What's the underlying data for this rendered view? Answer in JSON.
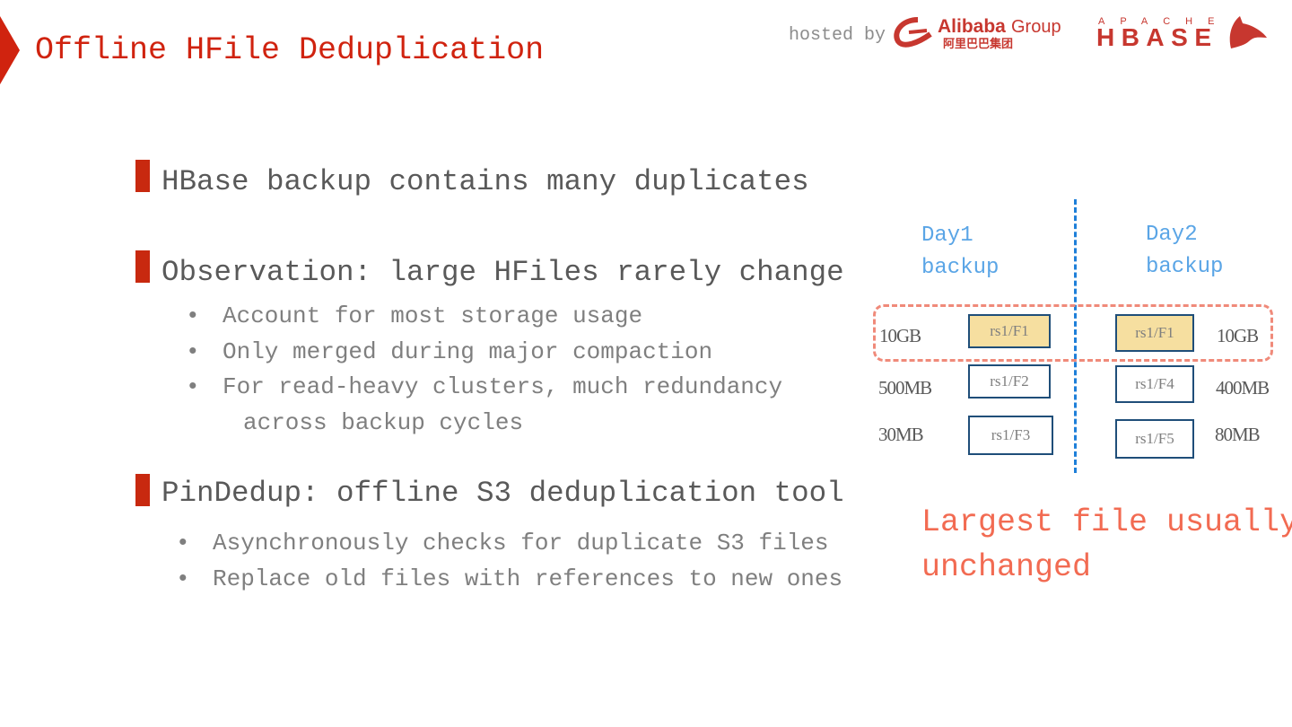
{
  "header": {
    "title": "Offline HFile Deduplication",
    "hosted_by": "hosted by",
    "logos": [
      "Alibaba Group 阿里巴巴集团",
      "APACHE HBASE"
    ]
  },
  "bullets": [
    {
      "text": "HBase backup contains many duplicates",
      "sub": []
    },
    {
      "text": "Observation: large HFiles rarely change",
      "sub": [
        "Account for most storage usage",
        "Only merged during major compaction",
        "For read-heavy clusters, much redundancy",
        "across backup cycles"
      ]
    },
    {
      "text": "PinDedup: offline S3 deduplication tool",
      "sub": [
        "Asynchronously checks for duplicate S3 files",
        "Replace old files with references to new ones"
      ]
    }
  ],
  "diagram": {
    "day1": [
      "Day1",
      "backup"
    ],
    "day2": [
      "Day2",
      "backup"
    ],
    "day1_files": [
      {
        "name": "rs1/F1",
        "size": "10GB"
      },
      {
        "name": "rs1/F2",
        "size": "500MB"
      },
      {
        "name": "rs1/F3",
        "size": "30MB"
      }
    ],
    "day2_files": [
      {
        "name": "rs1/F1",
        "size": "10GB"
      },
      {
        "name": "rs1/F4",
        "size": "400MB"
      },
      {
        "name": "rs1/F5",
        "size": "80MB"
      }
    ],
    "caption": [
      "Largest file usually",
      "unchanged"
    ],
    "colors": {
      "highlight": "#f6dfa0",
      "dash": "#f08a7a",
      "divider": "#1e7fd9"
    }
  }
}
